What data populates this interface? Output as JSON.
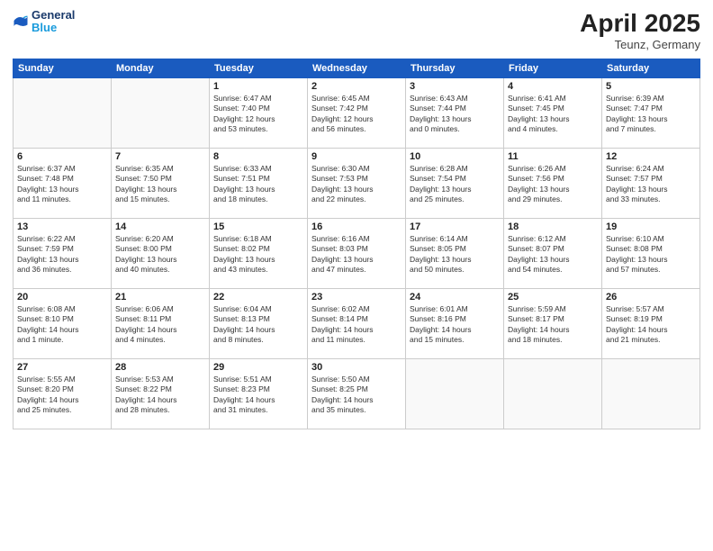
{
  "header": {
    "logo_line1": "General",
    "logo_line2": "Blue",
    "month_year": "April 2025",
    "location": "Teunz, Germany"
  },
  "weekdays": [
    "Sunday",
    "Monday",
    "Tuesday",
    "Wednesday",
    "Thursday",
    "Friday",
    "Saturday"
  ],
  "weeks": [
    [
      {
        "day": "",
        "info": ""
      },
      {
        "day": "",
        "info": ""
      },
      {
        "day": "1",
        "info": "Sunrise: 6:47 AM\nSunset: 7:40 PM\nDaylight: 12 hours\nand 53 minutes."
      },
      {
        "day": "2",
        "info": "Sunrise: 6:45 AM\nSunset: 7:42 PM\nDaylight: 12 hours\nand 56 minutes."
      },
      {
        "day": "3",
        "info": "Sunrise: 6:43 AM\nSunset: 7:44 PM\nDaylight: 13 hours\nand 0 minutes."
      },
      {
        "day": "4",
        "info": "Sunrise: 6:41 AM\nSunset: 7:45 PM\nDaylight: 13 hours\nand 4 minutes."
      },
      {
        "day": "5",
        "info": "Sunrise: 6:39 AM\nSunset: 7:47 PM\nDaylight: 13 hours\nand 7 minutes."
      }
    ],
    [
      {
        "day": "6",
        "info": "Sunrise: 6:37 AM\nSunset: 7:48 PM\nDaylight: 13 hours\nand 11 minutes."
      },
      {
        "day": "7",
        "info": "Sunrise: 6:35 AM\nSunset: 7:50 PM\nDaylight: 13 hours\nand 15 minutes."
      },
      {
        "day": "8",
        "info": "Sunrise: 6:33 AM\nSunset: 7:51 PM\nDaylight: 13 hours\nand 18 minutes."
      },
      {
        "day": "9",
        "info": "Sunrise: 6:30 AM\nSunset: 7:53 PM\nDaylight: 13 hours\nand 22 minutes."
      },
      {
        "day": "10",
        "info": "Sunrise: 6:28 AM\nSunset: 7:54 PM\nDaylight: 13 hours\nand 25 minutes."
      },
      {
        "day": "11",
        "info": "Sunrise: 6:26 AM\nSunset: 7:56 PM\nDaylight: 13 hours\nand 29 minutes."
      },
      {
        "day": "12",
        "info": "Sunrise: 6:24 AM\nSunset: 7:57 PM\nDaylight: 13 hours\nand 33 minutes."
      }
    ],
    [
      {
        "day": "13",
        "info": "Sunrise: 6:22 AM\nSunset: 7:59 PM\nDaylight: 13 hours\nand 36 minutes."
      },
      {
        "day": "14",
        "info": "Sunrise: 6:20 AM\nSunset: 8:00 PM\nDaylight: 13 hours\nand 40 minutes."
      },
      {
        "day": "15",
        "info": "Sunrise: 6:18 AM\nSunset: 8:02 PM\nDaylight: 13 hours\nand 43 minutes."
      },
      {
        "day": "16",
        "info": "Sunrise: 6:16 AM\nSunset: 8:03 PM\nDaylight: 13 hours\nand 47 minutes."
      },
      {
        "day": "17",
        "info": "Sunrise: 6:14 AM\nSunset: 8:05 PM\nDaylight: 13 hours\nand 50 minutes."
      },
      {
        "day": "18",
        "info": "Sunrise: 6:12 AM\nSunset: 8:07 PM\nDaylight: 13 hours\nand 54 minutes."
      },
      {
        "day": "19",
        "info": "Sunrise: 6:10 AM\nSunset: 8:08 PM\nDaylight: 13 hours\nand 57 minutes."
      }
    ],
    [
      {
        "day": "20",
        "info": "Sunrise: 6:08 AM\nSunset: 8:10 PM\nDaylight: 14 hours\nand 1 minute."
      },
      {
        "day": "21",
        "info": "Sunrise: 6:06 AM\nSunset: 8:11 PM\nDaylight: 14 hours\nand 4 minutes."
      },
      {
        "day": "22",
        "info": "Sunrise: 6:04 AM\nSunset: 8:13 PM\nDaylight: 14 hours\nand 8 minutes."
      },
      {
        "day": "23",
        "info": "Sunrise: 6:02 AM\nSunset: 8:14 PM\nDaylight: 14 hours\nand 11 minutes."
      },
      {
        "day": "24",
        "info": "Sunrise: 6:01 AM\nSunset: 8:16 PM\nDaylight: 14 hours\nand 15 minutes."
      },
      {
        "day": "25",
        "info": "Sunrise: 5:59 AM\nSunset: 8:17 PM\nDaylight: 14 hours\nand 18 minutes."
      },
      {
        "day": "26",
        "info": "Sunrise: 5:57 AM\nSunset: 8:19 PM\nDaylight: 14 hours\nand 21 minutes."
      }
    ],
    [
      {
        "day": "27",
        "info": "Sunrise: 5:55 AM\nSunset: 8:20 PM\nDaylight: 14 hours\nand 25 minutes."
      },
      {
        "day": "28",
        "info": "Sunrise: 5:53 AM\nSunset: 8:22 PM\nDaylight: 14 hours\nand 28 minutes."
      },
      {
        "day": "29",
        "info": "Sunrise: 5:51 AM\nSunset: 8:23 PM\nDaylight: 14 hours\nand 31 minutes."
      },
      {
        "day": "30",
        "info": "Sunrise: 5:50 AM\nSunset: 8:25 PM\nDaylight: 14 hours\nand 35 minutes."
      },
      {
        "day": "",
        "info": ""
      },
      {
        "day": "",
        "info": ""
      },
      {
        "day": "",
        "info": ""
      }
    ]
  ]
}
